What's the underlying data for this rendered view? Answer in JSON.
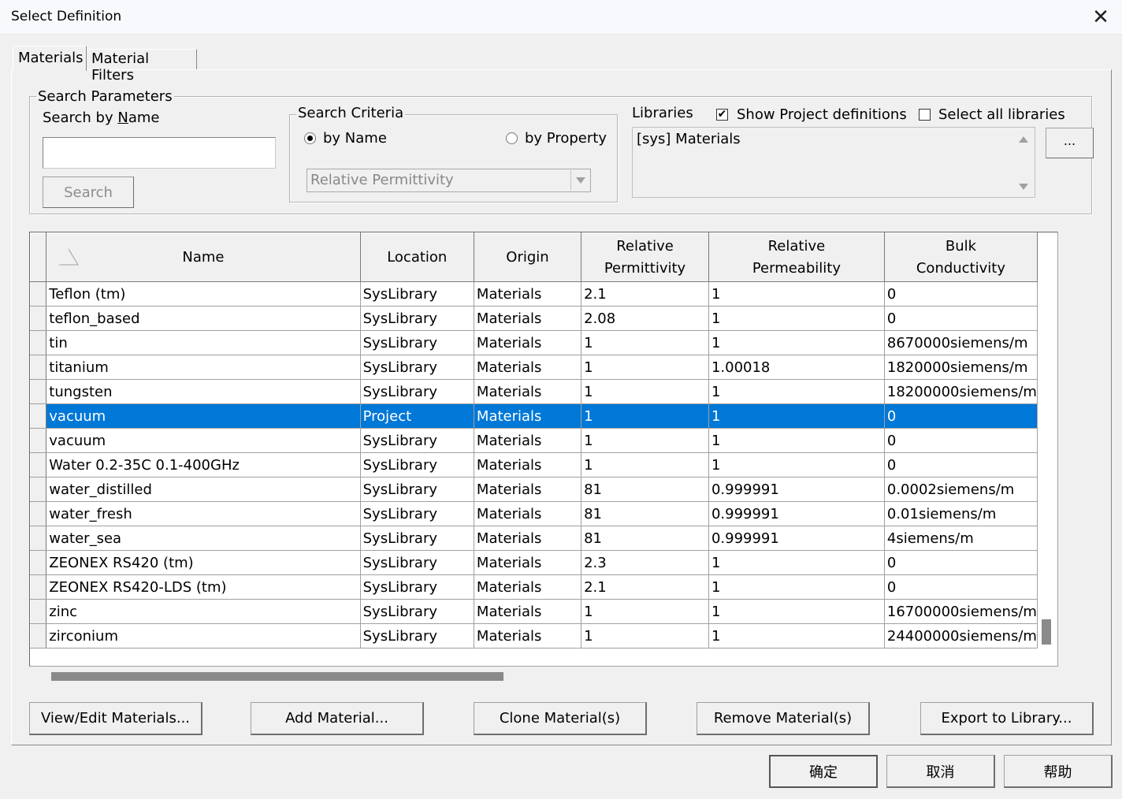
{
  "window": {
    "title": "Select Definition",
    "close_symbol": "✕"
  },
  "tabs": [
    {
      "label": "Materials",
      "active": true
    },
    {
      "label": "Material Filters",
      "active": false
    }
  ],
  "search_parameters": {
    "legend": "Search Parameters",
    "search_by_name_label": "Search by Name",
    "search_value": "",
    "search_button": "Search"
  },
  "search_criteria": {
    "legend": "Search Criteria",
    "by_name": {
      "label": "by Name",
      "checked": true
    },
    "by_property": {
      "label": "by Property",
      "checked": false
    },
    "property_select": "Relative Permittivity"
  },
  "libraries": {
    "label": "Libraries",
    "show_project": {
      "label": "Show Project definitions",
      "checked": true
    },
    "select_all": {
      "label": "Select all libraries",
      "checked": false
    },
    "items": [
      "[sys] Materials"
    ],
    "browse_button": "..."
  },
  "grid": {
    "columns": [
      {
        "label": "Name"
      },
      {
        "label": "Location"
      },
      {
        "label": "Origin"
      },
      {
        "label": "Relative Permittivity"
      },
      {
        "label": "Relative Permeability"
      },
      {
        "label": "Bulk Conductivity"
      }
    ],
    "rows": [
      [
        "Teflon (tm)",
        "SysLibrary",
        "Materials",
        "2.1",
        "1",
        "0"
      ],
      [
        "teflon_based",
        "SysLibrary",
        "Materials",
        "2.08",
        "1",
        "0"
      ],
      [
        "tin",
        "SysLibrary",
        "Materials",
        "1",
        "1",
        "8670000siemens/m"
      ],
      [
        "titanium",
        "SysLibrary",
        "Materials",
        "1",
        "1.00018",
        "1820000siemens/m"
      ],
      [
        "tungsten",
        "SysLibrary",
        "Materials",
        "1",
        "1",
        "18200000siemens/m"
      ],
      [
        "vacuum",
        "Project",
        "Materials",
        "1",
        "1",
        "0"
      ],
      [
        "vacuum",
        "SysLibrary",
        "Materials",
        "1",
        "1",
        "0"
      ],
      [
        "Water 0.2-35C 0.1-400GHz",
        "SysLibrary",
        "Materials",
        "1",
        "1",
        "0"
      ],
      [
        "water_distilled",
        "SysLibrary",
        "Materials",
        "81",
        "0.999991",
        "0.0002siemens/m"
      ],
      [
        "water_fresh",
        "SysLibrary",
        "Materials",
        "81",
        "0.999991",
        "0.01siemens/m"
      ],
      [
        "water_sea",
        "SysLibrary",
        "Materials",
        "81",
        "0.999991",
        "4siemens/m"
      ],
      [
        "ZEONEX RS420 (tm)",
        "SysLibrary",
        "Materials",
        "2.3",
        "1",
        "0"
      ],
      [
        "ZEONEX RS420-LDS (tm)",
        "SysLibrary",
        "Materials",
        "2.1",
        "1",
        "0"
      ],
      [
        "zinc",
        "SysLibrary",
        "Materials",
        "1",
        "1",
        "16700000siemens/m"
      ],
      [
        "zirconium",
        "SysLibrary",
        "Materials",
        "1",
        "1",
        "24400000siemens/m"
      ]
    ],
    "selected_row": 5,
    "selection_color": "#0078d7"
  },
  "action_buttons": {
    "view_edit": "View/Edit Materials...",
    "add": "Add Material...",
    "clone": "Clone Material(s)",
    "remove": "Remove Material(s)",
    "export": "Export to Library..."
  },
  "dialog_buttons": {
    "ok": "确定",
    "cancel": "取消",
    "help": "帮助"
  }
}
